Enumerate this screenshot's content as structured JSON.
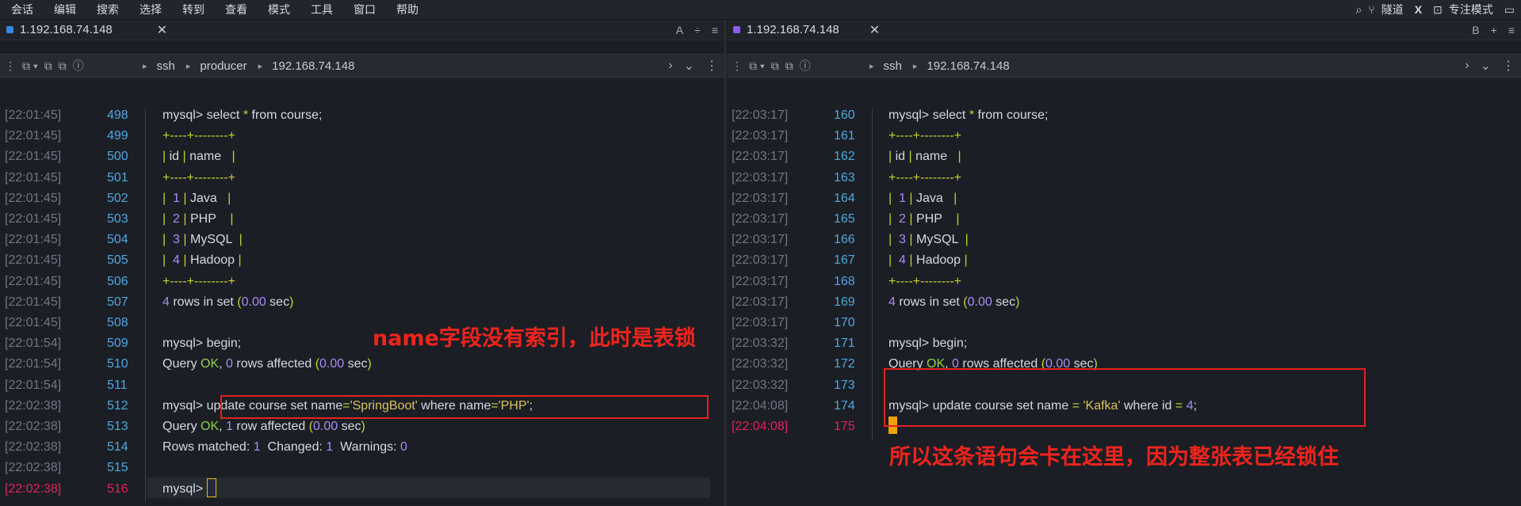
{
  "menu": [
    "会话",
    "编辑",
    "搜索",
    "选择",
    "转到",
    "查看",
    "模式",
    "工具",
    "窗口",
    "帮助"
  ],
  "menu_right": {
    "tunnel": "隧道",
    "x": "X",
    "focus": "专注模式"
  },
  "left": {
    "tab_title": "1.192.168.74.148",
    "tab_letter": "A",
    "breadcrumb": [
      "ssh",
      "producer",
      "192.168.74.148"
    ],
    "lines": [
      {
        "ts": "[22:01:45]",
        "n": "498"
      },
      {
        "ts": "[22:01:45]",
        "n": "499"
      },
      {
        "ts": "[22:01:45]",
        "n": "500"
      },
      {
        "ts": "[22:01:45]",
        "n": "501"
      },
      {
        "ts": "[22:01:45]",
        "n": "502"
      },
      {
        "ts": "[22:01:45]",
        "n": "503"
      },
      {
        "ts": "[22:01:45]",
        "n": "504"
      },
      {
        "ts": "[22:01:45]",
        "n": "505"
      },
      {
        "ts": "[22:01:45]",
        "n": "506"
      },
      {
        "ts": "[22:01:45]",
        "n": "507"
      },
      {
        "ts": "[22:01:45]",
        "n": "508"
      },
      {
        "ts": "[22:01:54]",
        "n": "509"
      },
      {
        "ts": "[22:01:54]",
        "n": "510"
      },
      {
        "ts": "[22:01:54]",
        "n": "511"
      },
      {
        "ts": "[22:02:38]",
        "n": "512"
      },
      {
        "ts": "[22:02:38]",
        "n": "513"
      },
      {
        "ts": "[22:02:38]",
        "n": "514"
      },
      {
        "ts": "[22:02:38]",
        "n": "515"
      },
      {
        "ts": "[22:02:38]",
        "n": "516"
      }
    ],
    "text": {
      "select": "mysql> select * from course;",
      "border": "+----+--------+",
      "header": "| id | name   |",
      "rows": [
        "|  1 | Java   |",
        "|  2 | PHP    |",
        "|  3 | MySQL  |",
        "|  4 | Hadoop |"
      ],
      "rowsinset": "4 rows in set (0.00 sec)",
      "begin": "mysql> begin;",
      "queryok": "Query OK, 0 rows affected (0.00 sec)",
      "update_prompt": "mysql> ",
      "update": "update course set name='SpringBoot' where name='PHP';",
      "queryok1": "Query OK, 1 row affected (0.00 sec)",
      "matched": "Rows matched: 1  Changed: 1  Warnings: 0",
      "prompt": "mysql> "
    },
    "annotation": "name字段没有索引，此时是表锁"
  },
  "right": {
    "tab_title": "1.192.168.74.148",
    "tab_letter": "B",
    "breadcrumb": [
      "ssh",
      "192.168.74.148"
    ],
    "lines": [
      {
        "ts": "[22:03:17]",
        "n": "160"
      },
      {
        "ts": "[22:03:17]",
        "n": "161"
      },
      {
        "ts": "[22:03:17]",
        "n": "162"
      },
      {
        "ts": "[22:03:17]",
        "n": "163"
      },
      {
        "ts": "[22:03:17]",
        "n": "164"
      },
      {
        "ts": "[22:03:17]",
        "n": "165"
      },
      {
        "ts": "[22:03:17]",
        "n": "166"
      },
      {
        "ts": "[22:03:17]",
        "n": "167"
      },
      {
        "ts": "[22:03:17]",
        "n": "168"
      },
      {
        "ts": "[22:03:17]",
        "n": "169"
      },
      {
        "ts": "[22:03:17]",
        "n": "170"
      },
      {
        "ts": "[22:03:32]",
        "n": "171"
      },
      {
        "ts": "[22:03:32]",
        "n": "172"
      },
      {
        "ts": "[22:03:32]",
        "n": "173"
      },
      {
        "ts": "[22:04:08]",
        "n": "174"
      },
      {
        "ts": "[22:04:08]",
        "n": "175"
      }
    ],
    "text": {
      "update": "mysql> update course set name = 'Kafka' where id = 4;"
    },
    "annotation": "所以这条语句会卡在这里，因为整张表已经锁住"
  },
  "colors": {
    "annotation": "#f0241c",
    "line_number": "#4fa7e0",
    "current_line": "#e0235b",
    "cursor": "#f0a300"
  }
}
